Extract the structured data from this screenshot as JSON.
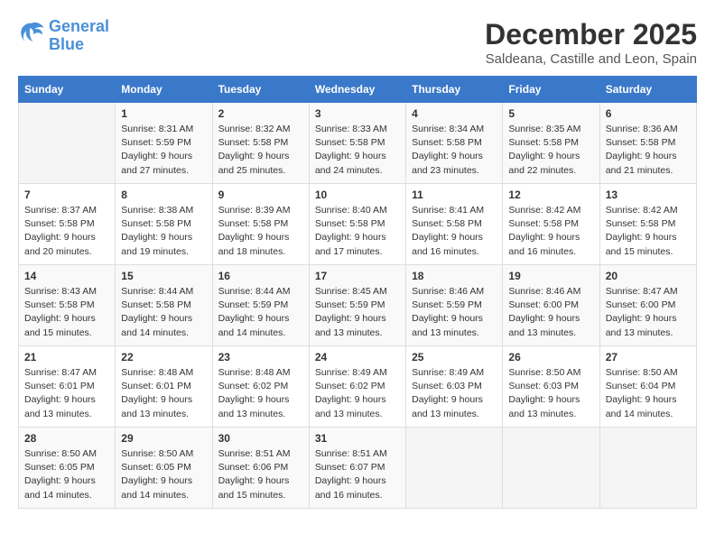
{
  "header": {
    "logo_line1": "General",
    "logo_line2": "Blue",
    "title": "December 2025",
    "subtitle": "Saldeana, Castille and Leon, Spain"
  },
  "weekdays": [
    "Sunday",
    "Monday",
    "Tuesday",
    "Wednesday",
    "Thursday",
    "Friday",
    "Saturday"
  ],
  "weeks": [
    [
      {
        "day": "",
        "sunrise": "",
        "sunset": "",
        "daylight": ""
      },
      {
        "day": "1",
        "sunrise": "8:31 AM",
        "sunset": "5:59 PM",
        "daylight": "9 hours and 27 minutes."
      },
      {
        "day": "2",
        "sunrise": "8:32 AM",
        "sunset": "5:58 PM",
        "daylight": "9 hours and 25 minutes."
      },
      {
        "day": "3",
        "sunrise": "8:33 AM",
        "sunset": "5:58 PM",
        "daylight": "9 hours and 24 minutes."
      },
      {
        "day": "4",
        "sunrise": "8:34 AM",
        "sunset": "5:58 PM",
        "daylight": "9 hours and 23 minutes."
      },
      {
        "day": "5",
        "sunrise": "8:35 AM",
        "sunset": "5:58 PM",
        "daylight": "9 hours and 22 minutes."
      },
      {
        "day": "6",
        "sunrise": "8:36 AM",
        "sunset": "5:58 PM",
        "daylight": "9 hours and 21 minutes."
      }
    ],
    [
      {
        "day": "7",
        "sunrise": "8:37 AM",
        "sunset": "5:58 PM",
        "daylight": "9 hours and 20 minutes."
      },
      {
        "day": "8",
        "sunrise": "8:38 AM",
        "sunset": "5:58 PM",
        "daylight": "9 hours and 19 minutes."
      },
      {
        "day": "9",
        "sunrise": "8:39 AM",
        "sunset": "5:58 PM",
        "daylight": "9 hours and 18 minutes."
      },
      {
        "day": "10",
        "sunrise": "8:40 AM",
        "sunset": "5:58 PM",
        "daylight": "9 hours and 17 minutes."
      },
      {
        "day": "11",
        "sunrise": "8:41 AM",
        "sunset": "5:58 PM",
        "daylight": "9 hours and 16 minutes."
      },
      {
        "day": "12",
        "sunrise": "8:42 AM",
        "sunset": "5:58 PM",
        "daylight": "9 hours and 16 minutes."
      },
      {
        "day": "13",
        "sunrise": "8:42 AM",
        "sunset": "5:58 PM",
        "daylight": "9 hours and 15 minutes."
      }
    ],
    [
      {
        "day": "14",
        "sunrise": "8:43 AM",
        "sunset": "5:58 PM",
        "daylight": "9 hours and 15 minutes."
      },
      {
        "day": "15",
        "sunrise": "8:44 AM",
        "sunset": "5:58 PM",
        "daylight": "9 hours and 14 minutes."
      },
      {
        "day": "16",
        "sunrise": "8:44 AM",
        "sunset": "5:59 PM",
        "daylight": "9 hours and 14 minutes."
      },
      {
        "day": "17",
        "sunrise": "8:45 AM",
        "sunset": "5:59 PM",
        "daylight": "9 hours and 13 minutes."
      },
      {
        "day": "18",
        "sunrise": "8:46 AM",
        "sunset": "5:59 PM",
        "daylight": "9 hours and 13 minutes."
      },
      {
        "day": "19",
        "sunrise": "8:46 AM",
        "sunset": "6:00 PM",
        "daylight": "9 hours and 13 minutes."
      },
      {
        "day": "20",
        "sunrise": "8:47 AM",
        "sunset": "6:00 PM",
        "daylight": "9 hours and 13 minutes."
      }
    ],
    [
      {
        "day": "21",
        "sunrise": "8:47 AM",
        "sunset": "6:01 PM",
        "daylight": "9 hours and 13 minutes."
      },
      {
        "day": "22",
        "sunrise": "8:48 AM",
        "sunset": "6:01 PM",
        "daylight": "9 hours and 13 minutes."
      },
      {
        "day": "23",
        "sunrise": "8:48 AM",
        "sunset": "6:02 PM",
        "daylight": "9 hours and 13 minutes."
      },
      {
        "day": "24",
        "sunrise": "8:49 AM",
        "sunset": "6:02 PM",
        "daylight": "9 hours and 13 minutes."
      },
      {
        "day": "25",
        "sunrise": "8:49 AM",
        "sunset": "6:03 PM",
        "daylight": "9 hours and 13 minutes."
      },
      {
        "day": "26",
        "sunrise": "8:50 AM",
        "sunset": "6:03 PM",
        "daylight": "9 hours and 13 minutes."
      },
      {
        "day": "27",
        "sunrise": "8:50 AM",
        "sunset": "6:04 PM",
        "daylight": "9 hours and 14 minutes."
      }
    ],
    [
      {
        "day": "28",
        "sunrise": "8:50 AM",
        "sunset": "6:05 PM",
        "daylight": "9 hours and 14 minutes."
      },
      {
        "day": "29",
        "sunrise": "8:50 AM",
        "sunset": "6:05 PM",
        "daylight": "9 hours and 14 minutes."
      },
      {
        "day": "30",
        "sunrise": "8:51 AM",
        "sunset": "6:06 PM",
        "daylight": "9 hours and 15 minutes."
      },
      {
        "day": "31",
        "sunrise": "8:51 AM",
        "sunset": "6:07 PM",
        "daylight": "9 hours and 16 minutes."
      },
      {
        "day": "",
        "sunrise": "",
        "sunset": "",
        "daylight": ""
      },
      {
        "day": "",
        "sunrise": "",
        "sunset": "",
        "daylight": ""
      },
      {
        "day": "",
        "sunrise": "",
        "sunset": "",
        "daylight": ""
      }
    ]
  ]
}
